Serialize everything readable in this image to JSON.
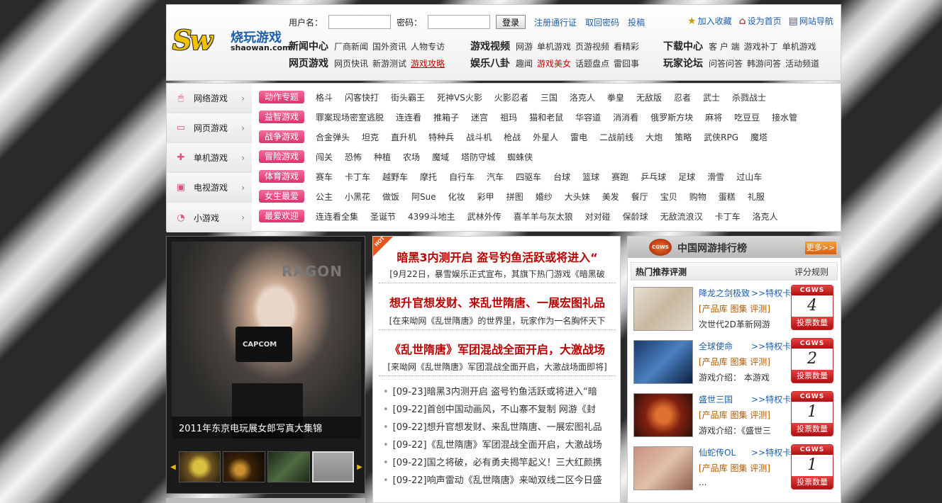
{
  "header": {
    "logo_sw": "Sw",
    "logo_cn": "烧玩游戏",
    "logo_en": "shaowan.com",
    "login": {
      "username_label": "用户名：",
      "password_label": "密码：",
      "login_button": "登录",
      "register": "注册通行证",
      "retrieve": "取回密码",
      "submit": "投稿"
    },
    "toplinks": [
      "加入收藏",
      "设为首页",
      "网站导航"
    ]
  },
  "nav": {
    "news_center": {
      "title": "新闻中心",
      "links": [
        "厂商新闻",
        "国外资讯",
        "人物专访"
      ]
    },
    "web_games": {
      "title": "网页游戏",
      "links": [
        "网页快讯",
        "新游测试",
        "游戏攻略"
      ]
    },
    "video": {
      "title": "游戏视频",
      "links": [
        "网游",
        "单机游戏",
        "页游视频",
        "看精彩"
      ]
    },
    "entertainment": {
      "title": "娱乐八卦",
      "links": [
        "趣闻",
        "游戏美女",
        "话题盘点",
        "雷囧事"
      ]
    },
    "download": {
      "title": "下载中心",
      "links": [
        "客 户 端",
        "游戏补丁",
        "单机游戏"
      ]
    },
    "forum": {
      "title": "玩家论坛",
      "links": [
        "问答问答",
        "韩游问答",
        "活动频道"
      ]
    }
  },
  "leftnav": [
    {
      "label": "网络游戏",
      "icon": "mouse-icon"
    },
    {
      "label": "网页游戏",
      "icon": "browser-icon"
    },
    {
      "label": "单机游戏",
      "icon": "gamepad-icon"
    },
    {
      "label": "电视游戏",
      "icon": "tv-icon"
    },
    {
      "label": "小游戏",
      "icon": "pie-icon"
    }
  ],
  "categories": [
    {
      "tag": "动作专题",
      "items": [
        "格斗",
        "闪客快打",
        "街头霸王",
        "死神VS火影",
        "火影忍者",
        "三国",
        "洛克人",
        "拳皇",
        "无敌版",
        "忍者",
        "武士",
        "杀戮战士"
      ]
    },
    {
      "tag": "益智游戏",
      "items": [
        "罪案现场密室逃脱",
        "连连看",
        "推箱子",
        "迷宫",
        "祖玛",
        "猫和老鼠",
        "华容道",
        "消消看",
        "俄罗斯方块",
        "麻将",
        "吃豆豆",
        "接水管"
      ]
    },
    {
      "tag": "战争游戏",
      "items": [
        "合金弹头",
        "坦克",
        "直升机",
        "特种兵",
        "战斗机",
        "枪战",
        "外星人",
        "雷电",
        "二战前线",
        "大炮",
        "策略",
        "武侠RPG",
        "魔塔"
      ]
    },
    {
      "tag": "冒险游戏",
      "items": [
        "闯关",
        "恐怖",
        "种植",
        "农场",
        "魔域",
        "塔防守城",
        "蜘蛛侠"
      ]
    },
    {
      "tag": "体育游戏",
      "items": [
        "赛车",
        "卡丁车",
        "越野车",
        "摩托",
        "自行车",
        "汽车",
        "四驱车",
        "台球",
        "篮球",
        "赛跑",
        "乒乓球",
        "足球",
        "滑雪",
        "过山车"
      ]
    },
    {
      "tag": "女生最爱",
      "items": [
        "公主",
        "小黑花",
        "做饭",
        "阿Sue",
        "化妆",
        "彩甲",
        "拼图",
        "婚纱",
        "大头妹",
        "美发",
        "餐厅",
        "宝贝",
        "购物",
        "蛋糕",
        "礼服"
      ]
    },
    {
      "tag": "最爱欢迎",
      "items": [
        "连连看全集",
        "圣诞节",
        "4399斗地主",
        "武林外传",
        "喜羊羊与灰太狼",
        "对对碰",
        "保龄球",
        "无敌流浪汉",
        "卡丁车",
        "洛克人"
      ]
    }
  ],
  "slideshow": {
    "caption": "2011年东京电玩展女郎写真大集锦",
    "wall_text": "RAGON",
    "shirt_text": "CAPCOM"
  },
  "news": {
    "hot": "HOT",
    "items": [
      {
        "headline": "暗黑3内测开启 盗号钓鱼活跃或将进入“",
        "sub": "[9月22日，暴雪娱乐正式宣布，其旗下热门游戏《暗黑破"
      },
      {
        "headline": "想升官想发财、来乱世隋唐、一展宏图礼品",
        "sub": "[在来呦网《乱世隋唐》的世界里，玩家作为一名胸怀天下"
      },
      {
        "headline": "《乱世隋唐》军团混战全面开启，大激战场",
        "sub": "[来呦网《乱世隋唐》军团混战全面开启，大激战场面即将]"
      }
    ],
    "list": [
      "[09-23]暗黑3内测开启 盗号钓鱼活跃或将进入“暗",
      "[09-22]首创中国动画风，不山寨不复制 网游《封",
      "[09-22]想升官想发财、来乱世隋唐、一展宏图礼品",
      "[09-22]《乱世隋唐》军团混战全面开启，大激战场",
      "[09-22]国之将破，必有勇夫揭竿起义！三大红颜携",
      "[09-22]响声雷动《乱世隋唐》来呦双线二区今日盛"
    ]
  },
  "ranking": {
    "logo": "CGWS",
    "title": "中国网游排行榜",
    "more": "更多>>",
    "sub_left": "热门推荐评测",
    "sub_right": "评分规则",
    "badge": "CGWS",
    "vote_label": "投票数量",
    "items": [
      {
        "name": "降龙之剑极致",
        "ticket": ">>特权卡",
        "links": "[产品库 图集 评测]",
        "desc": "次世代2D革新网游",
        "votes": "4"
      },
      {
        "name": "全球使命",
        "ticket": ">>特权卡",
        "links": "[产品库 图集 评测]",
        "desc": "游戏介绍： 本游戏",
        "votes": "2"
      },
      {
        "name": "盛世三国",
        "ticket": ">>特权卡",
        "links": "[产品库 图集 评测]",
        "desc": "游戏介绍：《盛世三",
        "votes": "1"
      },
      {
        "name": "仙蛇传OL",
        "ticket": ">>特权卡",
        "links": "[产品库 图集 评测]",
        "desc": "...",
        "votes": "1"
      }
    ]
  }
}
